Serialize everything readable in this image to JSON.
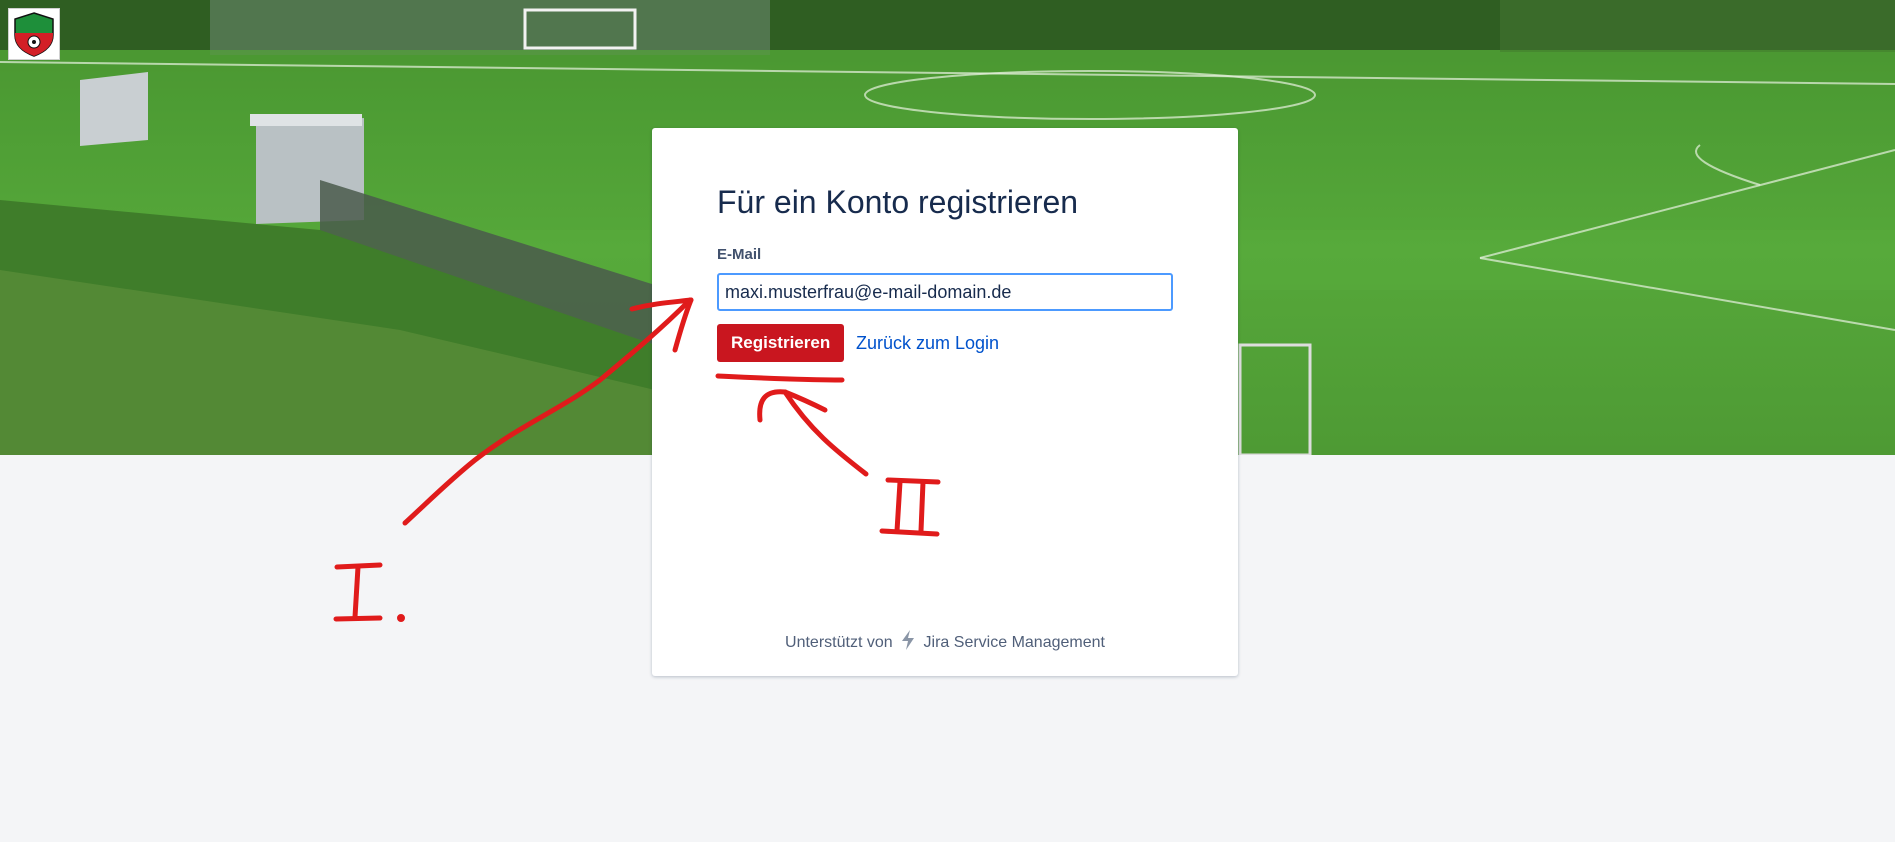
{
  "form": {
    "title": "Für ein Konto registrieren",
    "email_label": "E-Mail",
    "email_value": "maxi.musterfrau@e-mail-domain.de",
    "submit_label": "Registrieren",
    "back_link": "Zurück zum Login"
  },
  "footer": {
    "powered_prefix": "Unterstützt von",
    "powered_product": "Jira Service Management"
  },
  "annotations": {
    "label_one": "I.",
    "label_two": "II"
  },
  "colors": {
    "accent": "#c9161f",
    "link": "#0052cc",
    "annotation": "#e01b1b",
    "focus": "#4c9aff"
  },
  "icons": [
    "club-logo-icon",
    "jira-bolt-icon"
  ]
}
